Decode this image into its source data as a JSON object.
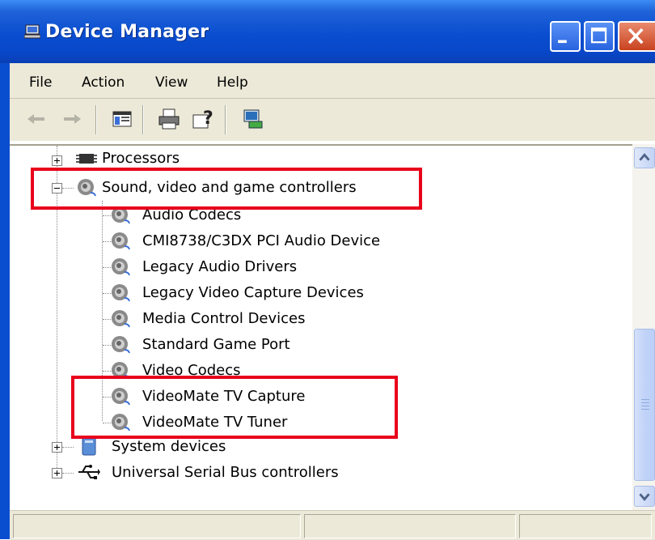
{
  "window": {
    "title": "Device Manager",
    "icon": "computer-icon",
    "controls": [
      "minimize-icon",
      "maximize-icon",
      "close-icon"
    ]
  },
  "menu": {
    "items": [
      "File",
      "Action",
      "View",
      "Help"
    ]
  },
  "toolbar": {
    "buttons": [
      "back-arrow-icon",
      "forward-arrow-icon",
      "show-hide-console-tree-icon",
      "print-icon",
      "help-icon",
      "scan-hardware-icon"
    ]
  },
  "tree": {
    "top_item": "Processors",
    "sound_category": "Sound, video and game controllers",
    "children": [
      "Audio Codecs",
      "CMI8738/C3DX PCI Audio Device",
      "Legacy Audio Drivers",
      "Legacy Video Capture Devices",
      "Media Control Devices",
      "Standard Game Port",
      "Video Codecs",
      "VideoMate TV Capture",
      "VideoMate TV Tuner"
    ],
    "after": [
      "System devices",
      "Universal Serial Bus controllers"
    ]
  },
  "colors": {
    "title_bar": "#0a4ed0",
    "highlight_box": "#e8001b",
    "chrome": "#ece9d8"
  }
}
